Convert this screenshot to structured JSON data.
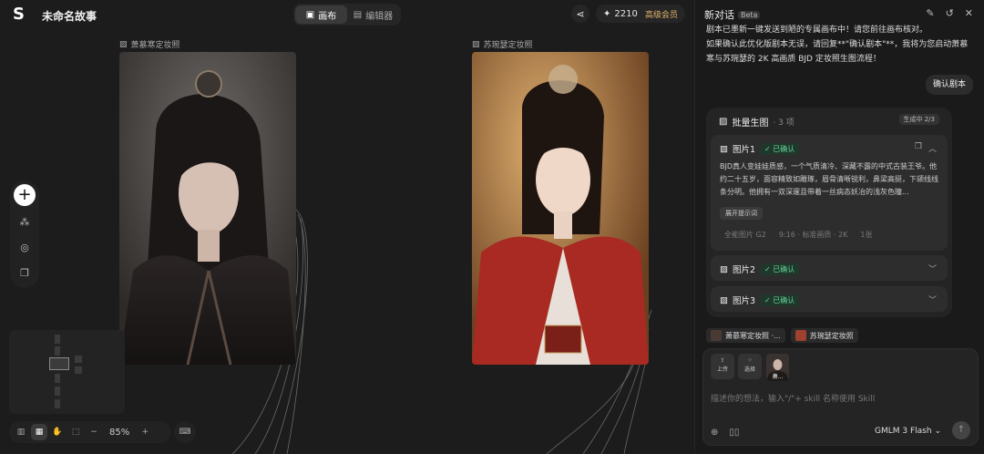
{
  "app": {
    "title": "未命名故事",
    "logo": "S"
  },
  "tabs": [
    {
      "label": "画布",
      "icon": "canvas-icon",
      "active": true
    },
    {
      "label": "编辑器",
      "icon": "film-icon",
      "active": false
    }
  ],
  "header": {
    "credits": "2210",
    "vip": "高级会员"
  },
  "canvas": {
    "images": [
      {
        "label": "萧慕寒定妆照"
      },
      {
        "label": "苏琬瑟定妆照"
      }
    ],
    "zoom": "85%"
  },
  "panel": {
    "title": "新对话",
    "beta": "Beta",
    "assistant_msg": "剧本已墨新一键发送到陋的专属画布中！请您前往画布核对。\n如果确认此优化版剧本无误，请回复**\"确认剧本\"**，我将为您启动萧慕寒与苏琬瑟的 2K 高画质 BJD 定妆照生图流程！",
    "user_msg": "确认剧本",
    "batch": {
      "title": "批量生图",
      "count": "· 3 项",
      "status": "生成中 2/3",
      "items": [
        {
          "title": "图片1",
          "badge": "已确认",
          "desc": "BJD真人变娃娃质感，一个气质清冷、深藏不露的中式古装王爷。他约二十五岁，面容精致如雕琢，眉骨清晰锐利，鼻梁高挺，下颌线线条分明。他拥有一双深邃且带着一丝病态妖冶的浅灰色瞳...",
          "expand": "展开提示词",
          "model": "全能图片 G2",
          "ratio": "9:16 · 标准画质 · 2K",
          "num": "1张"
        },
        {
          "title": "图片2",
          "badge": "已确认"
        },
        {
          "title": "图片3",
          "badge": "已确认"
        }
      ]
    },
    "refs": [
      {
        "label": "萧慕寒定妆照 ·..."
      },
      {
        "label": "苏琬瑟定妆照"
      }
    ],
    "input": {
      "upload": "上传",
      "select": "选择",
      "thumb": "萧...",
      "placeholder": "描述你的想法，输入\"/\"+ skill 名称使用 Skill",
      "model": "GMLM 3 Flash"
    }
  }
}
